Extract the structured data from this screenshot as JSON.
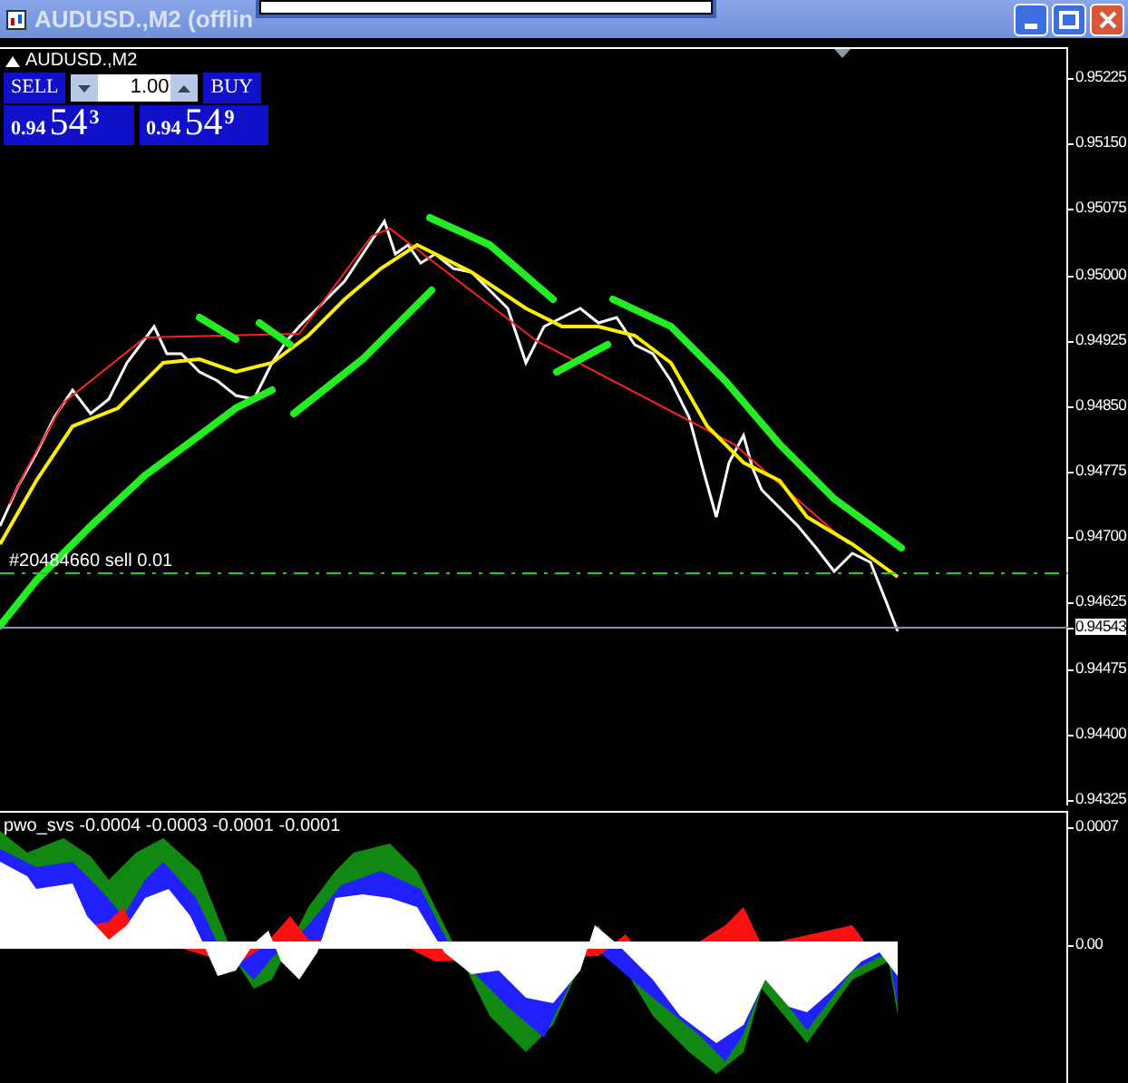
{
  "window": {
    "title": "AUDUSD.,M2 (offlin"
  },
  "chart": {
    "symbol_label": "AUDUSD.,M2",
    "trade_panel": {
      "sell_label": "SELL",
      "buy_label": "BUY",
      "volume": "1.00",
      "bid": {
        "big": "0.94",
        "pips": "54",
        "point": "3"
      },
      "ask": {
        "big": "0.94",
        "pips": "54",
        "point": "9"
      }
    },
    "price_axis": [
      "0.95225",
      "0.95150",
      "0.95075",
      "0.95000",
      "0.94925",
      "0.94850",
      "0.94775",
      "0.94700",
      "0.94625",
      "0.94475",
      "0.94400",
      "0.94325"
    ],
    "current_price": "0.94543",
    "order_line": {
      "label": "#20484660 sell 0.01"
    }
  },
  "indicator": {
    "label": "pwo_svs -0.0004 -0.0003 -0.0001 -0.0001",
    "axis": [
      "0.0007",
      "0.00"
    ]
  }
}
